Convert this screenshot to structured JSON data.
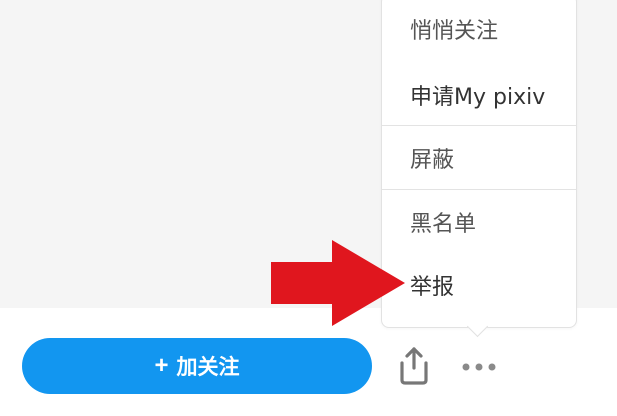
{
  "menu": {
    "items": [
      {
        "label": "悄悄关注"
      },
      {
        "label": "申请My pixiv"
      },
      {
        "label": "屏蔽"
      },
      {
        "label": "黑名单"
      },
      {
        "label": "举报"
      }
    ]
  },
  "actions": {
    "follow_label": "加关注",
    "follow_icon": "plus-icon",
    "share_icon": "share-icon",
    "more_icon": "more-icon"
  },
  "colors": {
    "follow_button": "#1296f0",
    "arrow": "#e0161e"
  }
}
